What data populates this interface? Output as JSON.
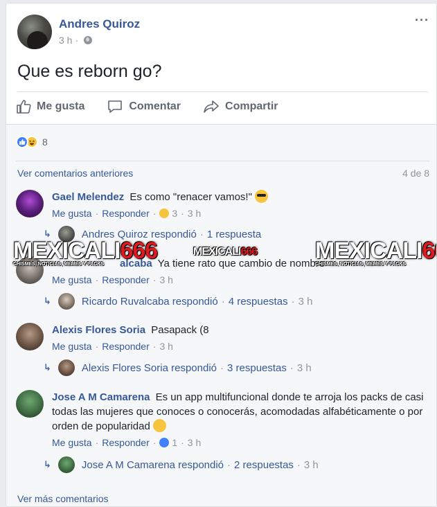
{
  "post": {
    "author": "Andres Quiroz",
    "time": "3 h",
    "text": "Que es reborn go?",
    "more_menu": "···"
  },
  "actions": {
    "like": "Me gusta",
    "comment": "Comentar",
    "share": "Compartir"
  },
  "reactions": {
    "count": "8"
  },
  "comments_nav": {
    "previous": "Ver comentarios anteriores",
    "position": "4 de 8",
    "more": "Ver más comentarios"
  },
  "comments": [
    {
      "name": "Gael Melendez",
      "text": "Es como \"renacer vamos!\"",
      "like": "Me gusta",
      "reply": "Responder",
      "reaction_count": "3",
      "time": "3 h",
      "reply_summary": {
        "author": "Andres Quiroz respondió",
        "count": "1 respuesta",
        "time": ""
      }
    },
    {
      "name": "Ricardo Ruvalcaba",
      "name_visible": "alcaba",
      "text": "Ya tiene rato que cambio de nombre",
      "like": "Me gusta",
      "reply": "Responder",
      "time": "3 h",
      "reply_summary": {
        "author": "Ricardo Ruvalcaba respondió",
        "count": "4 respuestas",
        "time": "3 h"
      }
    },
    {
      "name": "Alexis Flores Soria",
      "text": "Pasapack (8",
      "like": "Me gusta",
      "reply": "Responder",
      "time": "3 h",
      "reply_summary": {
        "author": "Alexis Flores Soria respondió",
        "count": "3 respuestas",
        "time": "3 h"
      }
    },
    {
      "name": "Jose A M Camarena",
      "text": "Es un app multifuncional donde te arroja los packs de casi todas las mujeres que conoces o conocerás, acomodadas alfabéticamente o por orden de popularidad",
      "like": "Me gusta",
      "reply": "Responder",
      "reaction_count": "1",
      "time": "3 h",
      "reply_summary": {
        "author": "Jose A M Camarena respondió",
        "count": "2 respuestas",
        "time": "3 h"
      }
    }
  ],
  "watermark": {
    "brand": "MEXICALI",
    "number": "666",
    "tagline": "CHISMES, NOTICIAS, MEMES Y PACKS"
  },
  "colors": {
    "link": "#365899",
    "muted": "#90949c",
    "like_blue": "#4080ff",
    "haha_yellow": "#f7c53d",
    "watermark_red": "#e0191f"
  }
}
